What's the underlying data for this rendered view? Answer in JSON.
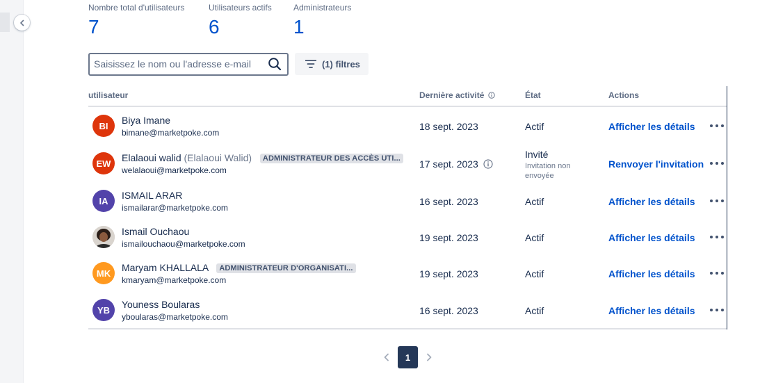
{
  "stats": [
    {
      "label": "Nombre total d'utilisateurs",
      "value": "7"
    },
    {
      "label": "Utilisateurs actifs",
      "value": "6"
    },
    {
      "label": "Administrateurs",
      "value": "1"
    }
  ],
  "search": {
    "placeholder": "Saisissez le nom ou l'adresse e-mail",
    "value": ""
  },
  "filter": {
    "label": "(1) filtres"
  },
  "table": {
    "columns": {
      "user": "utilisateur",
      "last_activity": "Dernière activité",
      "state": "État",
      "actions": "Actions"
    },
    "rows": [
      {
        "initials": "BI",
        "avatar_color": "#de350b",
        "name": "Biya Imane",
        "alias": "",
        "badge": "",
        "email": "bimane@marketpoke.com",
        "last_activity": "18 sept. 2023",
        "state": "Actif",
        "state_note": "",
        "action": "Afficher les détails"
      },
      {
        "initials": "EW",
        "avatar_color": "#de350b",
        "name": "Elalaoui walid",
        "alias": "(Elalaoui Walid)",
        "badge": "ADMINISTRATEUR DES ACCÈS UTI...",
        "email": "welalaoui@marketpoke.com",
        "last_activity": "17 sept. 2023",
        "state": "Invité",
        "state_note": "Invitation non envoyée",
        "action": "Renvoyer l'invitation"
      },
      {
        "initials": "IA",
        "avatar_color": "#5243aa",
        "name": "ISMAIL ARAR",
        "alias": "",
        "badge": "",
        "email": "ismailarar@marketpoke.com",
        "last_activity": "16 sept. 2023",
        "state": "Actif",
        "state_note": "",
        "action": "Afficher les détails"
      },
      {
        "initials": "",
        "avatar_color": "#3b2a22",
        "name": "Ismail Ouchaou",
        "alias": "",
        "badge": "",
        "email": "ismailouchaou@marketpoke.com",
        "last_activity": "19 sept. 2023",
        "state": "Actif",
        "state_note": "",
        "action": "Afficher les détails"
      },
      {
        "initials": "MK",
        "avatar_color": "#ff991f",
        "name": "Maryam KHALLALA",
        "alias": "",
        "badge": "ADMINISTRATEUR D'ORGANISATI...",
        "email": "kmaryam@marketpoke.com",
        "last_activity": "19 sept. 2023",
        "state": "Actif",
        "state_note": "",
        "action": "Afficher les détails"
      },
      {
        "initials": "YB",
        "avatar_color": "#5243aa",
        "name": "Youness Boularas",
        "alias": "",
        "badge": "",
        "email": "yboularas@marketpoke.com",
        "last_activity": "16 sept. 2023",
        "state": "Actif",
        "state_note": "",
        "action": "Afficher les détails"
      }
    ]
  },
  "pagination": {
    "current": "1"
  }
}
